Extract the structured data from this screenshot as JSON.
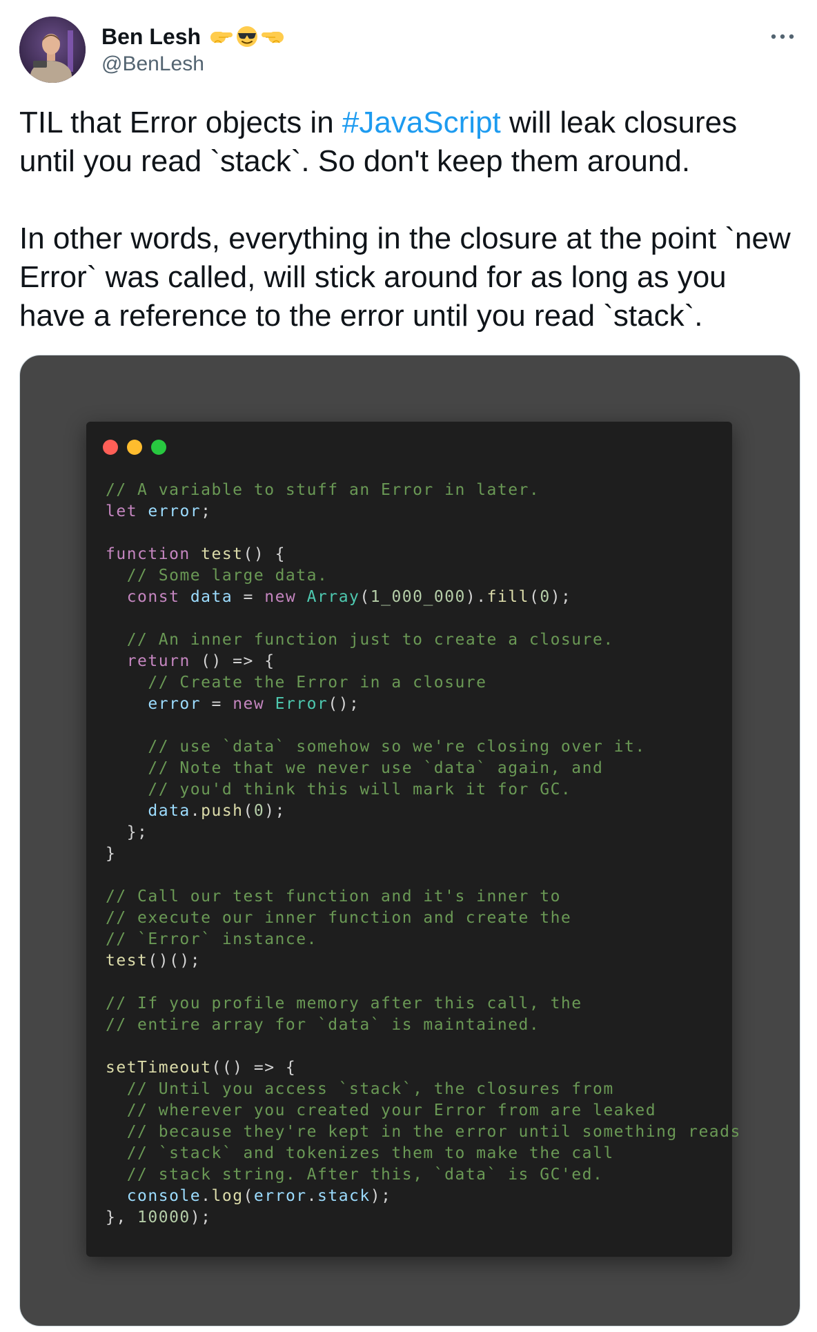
{
  "author": {
    "display_name": "Ben Lesh",
    "handle": "@BenLesh",
    "name_emojis": [
      "pointing-right-emoji",
      "cool-sunglasses-emoji",
      "pointing-left-emoji"
    ]
  },
  "tweet": {
    "paragraph1_before": "TIL that Error objects in ",
    "hashtag": "#JavaScript",
    "paragraph1_after": " will leak closures until you read `stack`. So don't keep them around.",
    "paragraph2": "In other words, everything in the closure at the point `new Error` was called, will stick around for as long as you have a reference to the error until you read `stack`."
  },
  "media": {
    "window_dots": [
      "#ff5f57",
      "#febc2e",
      "#28c840"
    ],
    "code_colors": {
      "comment": "#6a9955",
      "keyword": "#c586c0",
      "function": "#dcdcaa",
      "variable": "#9cdcfe",
      "class": "#4ec9b0",
      "number": "#b5cea8",
      "default": "#d4d4d4"
    },
    "code_lines": [
      [
        [
          "cmt",
          "// A variable to stuff an Error in later."
        ]
      ],
      [
        [
          "kw",
          "let"
        ],
        [
          "def",
          " "
        ],
        [
          "var",
          "error"
        ],
        [
          "def",
          ";"
        ]
      ],
      [],
      [
        [
          "kw",
          "function"
        ],
        [
          "def",
          " "
        ],
        [
          "fn",
          "test"
        ],
        [
          "def",
          "() {"
        ]
      ],
      [
        [
          "def",
          "  "
        ],
        [
          "cmt",
          "// Some large data."
        ]
      ],
      [
        [
          "def",
          "  "
        ],
        [
          "kw",
          "const"
        ],
        [
          "def",
          " "
        ],
        [
          "var",
          "data"
        ],
        [
          "def",
          " = "
        ],
        [
          "kw",
          "new"
        ],
        [
          "def",
          " "
        ],
        [
          "cls",
          "Array"
        ],
        [
          "def",
          "("
        ],
        [
          "num",
          "1_000_000"
        ],
        [
          "def",
          ")."
        ],
        [
          "fn",
          "fill"
        ],
        [
          "def",
          "("
        ],
        [
          "num",
          "0"
        ],
        [
          "def",
          ");"
        ]
      ],
      [],
      [
        [
          "def",
          "  "
        ],
        [
          "cmt",
          "// An inner function just to create a closure."
        ]
      ],
      [
        [
          "def",
          "  "
        ],
        [
          "kw",
          "return"
        ],
        [
          "def",
          " () => {"
        ]
      ],
      [
        [
          "def",
          "    "
        ],
        [
          "cmt",
          "// Create the Error in a closure"
        ]
      ],
      [
        [
          "def",
          "    "
        ],
        [
          "var",
          "error"
        ],
        [
          "def",
          " = "
        ],
        [
          "kw",
          "new"
        ],
        [
          "def",
          " "
        ],
        [
          "cls",
          "Error"
        ],
        [
          "def",
          "();"
        ]
      ],
      [],
      [
        [
          "def",
          "    "
        ],
        [
          "cmt",
          "// use `data` somehow so we're closing over it."
        ]
      ],
      [
        [
          "def",
          "    "
        ],
        [
          "cmt",
          "// Note that we never use `data` again, and"
        ]
      ],
      [
        [
          "def",
          "    "
        ],
        [
          "cmt",
          "// you'd think this will mark it for GC."
        ]
      ],
      [
        [
          "def",
          "    "
        ],
        [
          "var",
          "data"
        ],
        [
          "def",
          "."
        ],
        [
          "fn",
          "push"
        ],
        [
          "def",
          "("
        ],
        [
          "num",
          "0"
        ],
        [
          "def",
          ");"
        ]
      ],
      [
        [
          "def",
          "  };"
        ]
      ],
      [
        [
          "def",
          "}"
        ]
      ],
      [],
      [
        [
          "cmt",
          "// Call our test function and it's inner to"
        ]
      ],
      [
        [
          "cmt",
          "// execute our inner function and create the"
        ]
      ],
      [
        [
          "cmt",
          "// `Error` instance."
        ]
      ],
      [
        [
          "fn",
          "test"
        ],
        [
          "def",
          "()();"
        ]
      ],
      [],
      [
        [
          "cmt",
          "// If you profile memory after this call, the"
        ]
      ],
      [
        [
          "cmt",
          "// entire array for `data` is maintained."
        ]
      ],
      [],
      [
        [
          "fn",
          "setTimeout"
        ],
        [
          "def",
          "(() => {"
        ]
      ],
      [
        [
          "def",
          "  "
        ],
        [
          "cmt",
          "// Until you access `stack`, the closures from"
        ]
      ],
      [
        [
          "def",
          "  "
        ],
        [
          "cmt",
          "// wherever you created your Error from are leaked"
        ]
      ],
      [
        [
          "def",
          "  "
        ],
        [
          "cmt",
          "// because they're kept in the error until something reads"
        ]
      ],
      [
        [
          "def",
          "  "
        ],
        [
          "cmt",
          "// `stack` and tokenizes them to make the call"
        ]
      ],
      [
        [
          "def",
          "  "
        ],
        [
          "cmt",
          "// stack string. After this, `data` is GC'ed."
        ]
      ],
      [
        [
          "def",
          "  "
        ],
        [
          "var",
          "console"
        ],
        [
          "def",
          "."
        ],
        [
          "fn",
          "log"
        ],
        [
          "def",
          "("
        ],
        [
          "var",
          "error"
        ],
        [
          "def",
          "."
        ],
        [
          "var",
          "stack"
        ],
        [
          "def",
          ");"
        ]
      ],
      [
        [
          "def",
          "}, "
        ],
        [
          "num",
          "10000"
        ],
        [
          "def",
          ");"
        ]
      ]
    ]
  }
}
